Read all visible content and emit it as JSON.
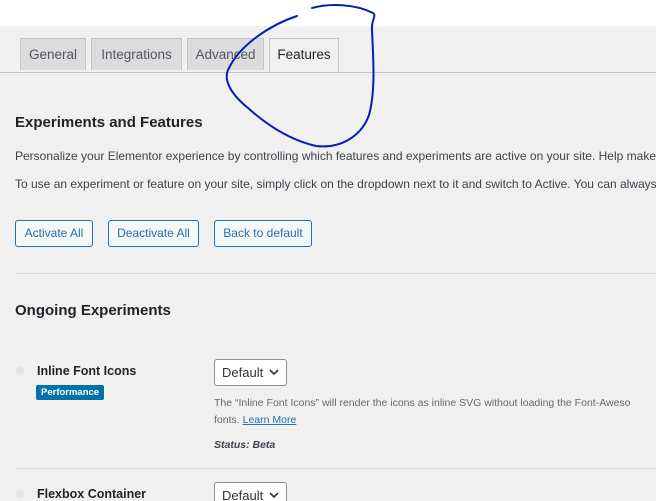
{
  "tabs": [
    {
      "label": "General",
      "active": false
    },
    {
      "label": "Integrations",
      "active": false
    },
    {
      "label": "Advanced",
      "active": false
    },
    {
      "label": "Features",
      "active": true
    }
  ],
  "section": {
    "title": "Experiments and Features",
    "description_1": "Personalize your Elementor experience by controlling which features and experiments are active on your site. Help make Eler",
    "description_2": "To use an experiment or feature on your site, simply click on the dropdown next to it and switch to Active. You can always de"
  },
  "actions": {
    "activate_all": "Activate All",
    "deactivate_all": "Deactivate All",
    "back_to_default": "Back to default"
  },
  "ongoing": {
    "title": "Ongoing Experiments",
    "items": [
      {
        "name": "Inline Font Icons",
        "tag": "Performance",
        "select_value": "Default",
        "description": "The “Inline Font Icons” will render the icons as inline SVG without loading the Font-Aweso",
        "description_cont": "fonts.",
        "learn_more": "Learn More",
        "status": "Status: Beta"
      },
      {
        "name": "Flexbox Container",
        "select_value": "Default"
      }
    ]
  },
  "colors": {
    "accent": "#2271b1",
    "badge": "#0073aa",
    "annotation": "#0a1cb4"
  },
  "icons": [
    "chevron-down-icon",
    "status-dot-icon"
  ]
}
